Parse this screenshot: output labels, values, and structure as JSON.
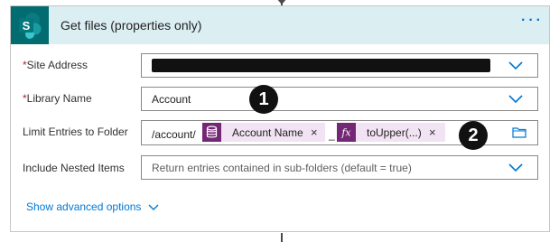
{
  "action": {
    "title": "Get files (properties only)",
    "menu_icon": "ellipsis-icon",
    "logo_icon": "sharepoint-logo-icon"
  },
  "fields": {
    "site_address": {
      "required_mark": "*",
      "label": "Site Address",
      "value_redacted": true
    },
    "library_name": {
      "required_mark": "*",
      "label": "Library Name",
      "value": "Account"
    },
    "limit_folder": {
      "label": "Limit Entries to Folder",
      "prefix": "/account/",
      "separator": "_",
      "tokens": [
        {
          "label": "Account Name",
          "icon": "dataverse-icon",
          "remove": "×"
        },
        {
          "label": "toUpper(...)",
          "icon": "fx-icon",
          "remove": "×"
        }
      ]
    },
    "nested_items": {
      "label": "Include Nested Items",
      "value": "Return entries contained in sub-folders (default = true)"
    }
  },
  "annotations": {
    "one": "1",
    "two": "2"
  },
  "footer": {
    "advanced_label": "Show advanced options"
  },
  "colors": {
    "header_bg": "#dbeef2",
    "sharepoint": "#036c70",
    "token_bg": "#f1e3f3",
    "token_icon": "#742774",
    "link": "#0078d4",
    "required": "#a4262c"
  }
}
